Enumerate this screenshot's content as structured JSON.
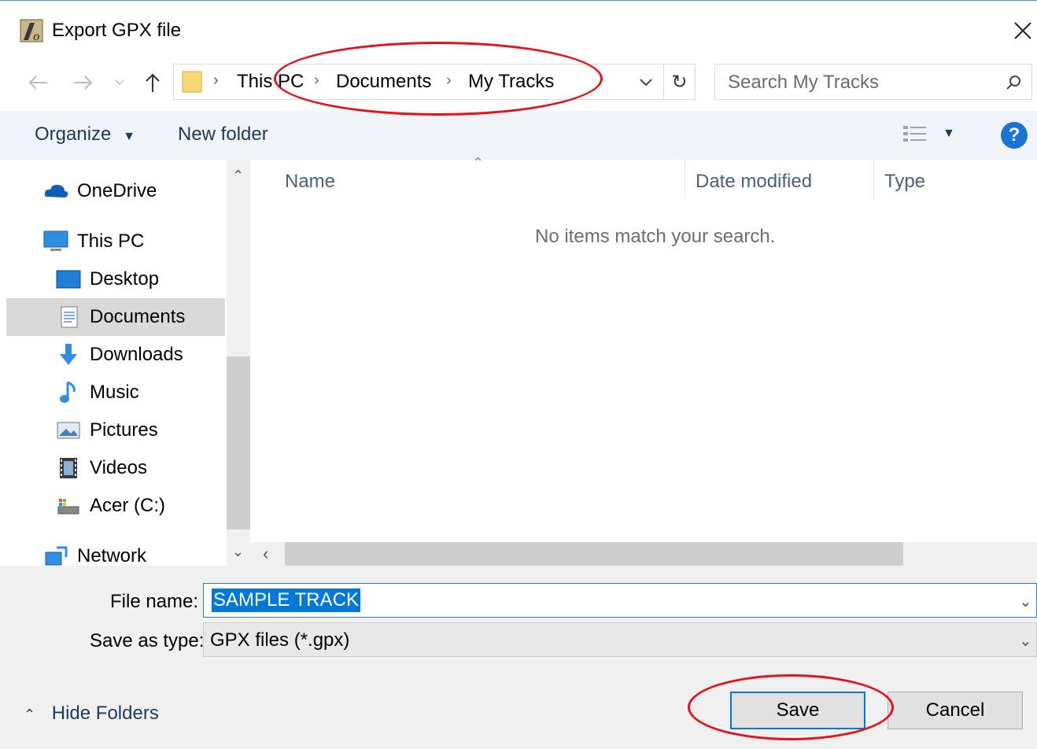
{
  "window": {
    "title": "Export GPX file"
  },
  "address_bar": {
    "breadcrumbs": [
      "This PC",
      "Documents",
      "My Tracks"
    ]
  },
  "search": {
    "placeholder": "Search My Tracks"
  },
  "command_bar": {
    "organize_label": "Organize",
    "new_folder_label": "New folder",
    "help_label": "?"
  },
  "nav_pane": {
    "items": [
      {
        "label": "OneDrive",
        "icon": "onedrive-icon",
        "selected": false
      },
      {
        "label": "This PC",
        "icon": "computer-icon",
        "selected": false
      },
      {
        "label": "Desktop",
        "icon": "desktop-icon",
        "selected": false
      },
      {
        "label": "Documents",
        "icon": "documents-icon",
        "selected": true
      },
      {
        "label": "Downloads",
        "icon": "downloads-icon",
        "selected": false
      },
      {
        "label": "Music",
        "icon": "music-icon",
        "selected": false
      },
      {
        "label": "Pictures",
        "icon": "pictures-icon",
        "selected": false
      },
      {
        "label": "Videos",
        "icon": "videos-icon",
        "selected": false
      },
      {
        "label": "Acer (C:)",
        "icon": "drive-icon",
        "selected": false
      },
      {
        "label": "Network",
        "icon": "network-icon",
        "selected": false
      }
    ]
  },
  "file_list": {
    "columns": [
      "Name",
      "Date modified",
      "Type"
    ],
    "empty_message": "No items match your search."
  },
  "form": {
    "file_name_label": "File name:",
    "file_name_value": "SAMPLE TRACK",
    "save_type_label": "Save as type:",
    "save_type_value": "GPX files (*.gpx)"
  },
  "footer": {
    "hide_folders_label": "Hide Folders",
    "save_label": "Save",
    "cancel_label": "Cancel"
  },
  "colors": {
    "accent": "#0078d7",
    "annotation": "#e0141e",
    "command_bar_bg": "#f0f4f9"
  }
}
